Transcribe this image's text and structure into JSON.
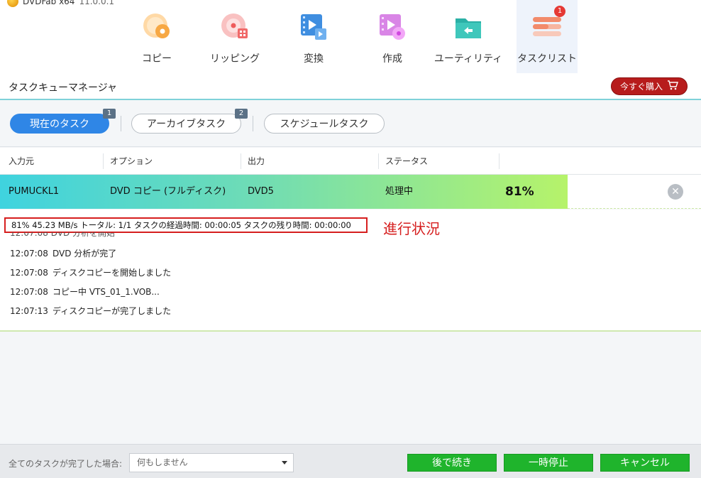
{
  "app": {
    "brand_name": "DVDFab x64",
    "version": "11.0.0.1"
  },
  "nav": {
    "items": [
      {
        "label": "コピー",
        "icon": "copy-disc-icon"
      },
      {
        "label": "リッピング",
        "icon": "ripper-disc-icon"
      },
      {
        "label": "変換",
        "icon": "video-convert-icon"
      },
      {
        "label": "作成",
        "icon": "creator-icon"
      },
      {
        "label": "ユーティリティ",
        "icon": "utility-folder-icon"
      },
      {
        "label": "タスクリスト",
        "icon": "task-list-icon",
        "badge": "1"
      }
    ],
    "active": "タスクリスト"
  },
  "header": {
    "title": "タスクキューマネージャ",
    "buy_label": "今すぐ購入"
  },
  "tabs": [
    {
      "label": "現在のタスク",
      "count": "1",
      "active": true
    },
    {
      "label": "アーカイブタスク",
      "count": "2",
      "active": false
    },
    {
      "label": "スケジュールタスク",
      "count": "",
      "active": false
    }
  ],
  "table": {
    "columns": [
      "入力元",
      "オプション",
      "出力",
      "ステータス"
    ],
    "row": {
      "source": "PUMUCKL1",
      "option": "DVD コピー (フルディスク)",
      "output": "DVD5",
      "status": "処理中",
      "percent": "81%",
      "progress_fraction": 0.81
    }
  },
  "log": {
    "status_line": "81%  45.23 MB/s  トータル: 1/1  タスクの経過時間: 00:00:05  タスクの残り時間: 00:00:00",
    "annotation": "進行状況",
    "partial_line": "12:07:08  DVD 分析を開始",
    "entries": [
      {
        "time": "12:07:08",
        "text": "DVD 分析が完了"
      },
      {
        "time": "12:07:08",
        "text": "ディスクコピーを開始しました"
      },
      {
        "time": "12:07:08",
        "text": "コピー中 VTS_01_1.VOB..."
      },
      {
        "time": "12:07:13",
        "text": "ディスクコピーが完了しました"
      }
    ]
  },
  "footer": {
    "completion_label": "全てのタスクが完了した場合:",
    "completion_value": "何もしません",
    "later_label": "後で続き",
    "pause_label": "一時停止",
    "cancel_label": "キャンセル"
  },
  "colors": {
    "accent_blue": "#2f86e6",
    "buy_red": "#b71c1c",
    "action_green": "#1fb42c",
    "annotation_red": "#d61f1f"
  }
}
